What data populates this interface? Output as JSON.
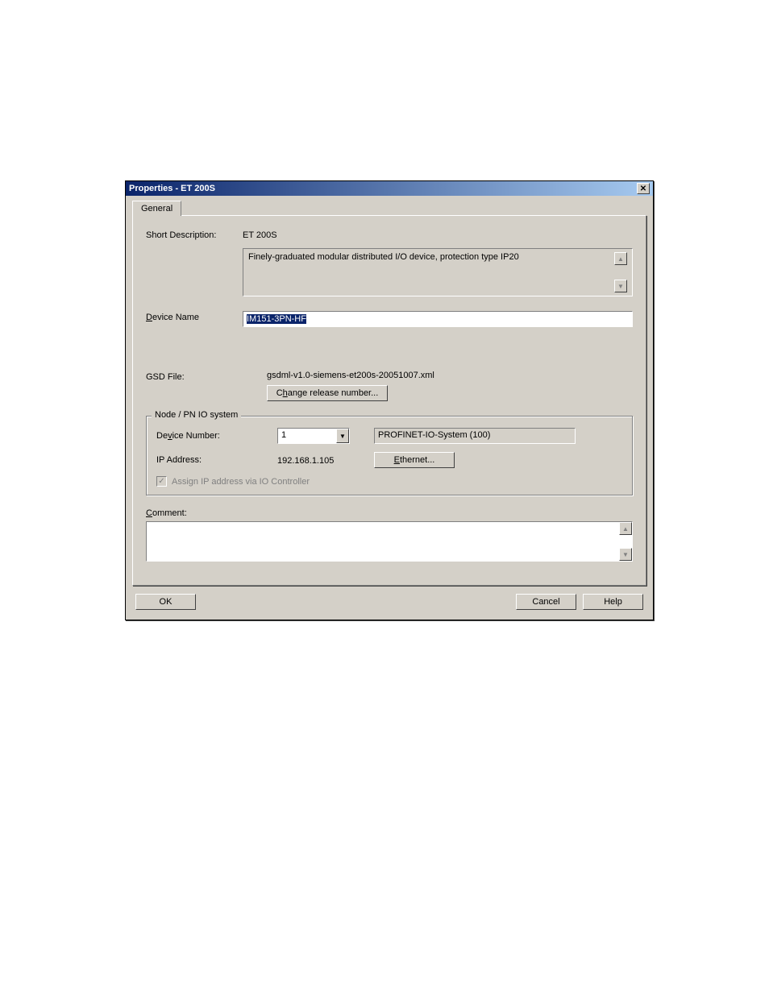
{
  "title": "Properties - ET 200S",
  "tab": "General",
  "short_desc_label": "Short Description:",
  "short_desc_value": "ET 200S",
  "short_desc_detail": "Finely-graduated modular distributed I/O device, protection type IP20",
  "device_name_label": "Device Name",
  "device_name_value": "IM151-3PN-HF",
  "gsd_label": "GSD File:",
  "gsd_value": "gsdml-v1.0-siemens-et200s-20051007.xml",
  "change_release_btn": "Change release number...",
  "groupbox_title": "Node / PN IO system",
  "device_number_label": "Device Number:",
  "device_number_value": "1",
  "pnio_system": "PROFINET-IO-System (100)",
  "ip_label": "IP Address:",
  "ip_value": "192.168.1.105",
  "ethernet_btn": "Ethernet...",
  "assign_ip_label": "Assign IP address via IO Controller",
  "comment_label": "Comment:",
  "ok_btn": "OK",
  "cancel_btn": "Cancel",
  "help_btn": "Help"
}
